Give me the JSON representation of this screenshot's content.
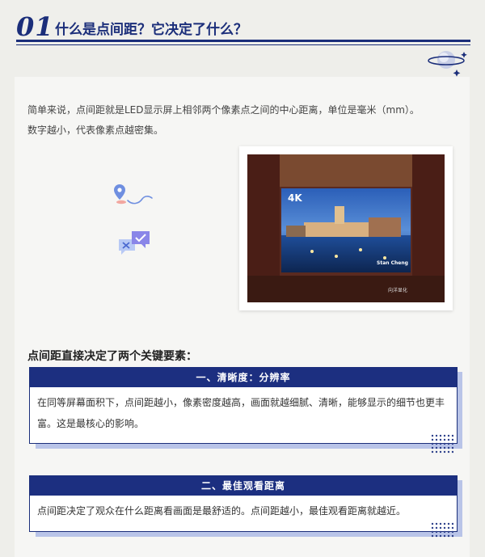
{
  "header": {
    "number": "01",
    "title": "什么是点间距？它决定了什么？"
  },
  "intro": {
    "line1": "简单来说，点间距就是LED显示屏上相邻两个像素点之间的中心距离，单位是毫米（mm）。",
    "line2": "数字越小，代表像素点越密集。"
  },
  "photo": {
    "badge": "4K",
    "caption": "Stan Cheng",
    "watermark": "向洋显化"
  },
  "section": {
    "heading": "点间距直接决定了两个关键要素："
  },
  "factors": [
    {
      "title": "一、清晰度：分辨率",
      "text": "在同等屏幕面积下，点间距越小，像素密度越高，画面就越细腻、清晰，能够显示的细节也更丰富。这是最核心的影响。"
    },
    {
      "title": "二、最佳观看距离",
      "text": "点间距决定了观众在什么距离看画面是最舒适的。点间距越小，最佳观看距离就越近。"
    }
  ],
  "colors": {
    "accent": "#1b2e7a",
    "bar": "#1c2f80",
    "shadow": "#b9c4e8"
  }
}
